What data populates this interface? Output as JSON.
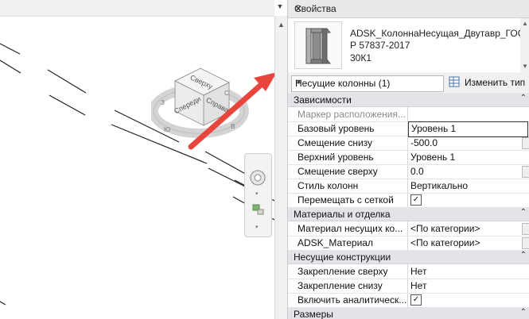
{
  "panel": {
    "title": "Свойства",
    "close_icon": "close-x-icon"
  },
  "type": {
    "line1": "ADSK_КолоннаНесущая_Двутавр_ГОСТ",
    "line2": "Р 57837-2017",
    "line3": "30К1"
  },
  "selector": {
    "value": "Несущие колонны (1)",
    "edit_type_label": "Изменить тип"
  },
  "viewcube": {
    "top": "Сверху",
    "front": "Спереди",
    "right": "Справа",
    "compass": [
      "С",
      "В",
      "Ю",
      "З"
    ]
  },
  "sections": [
    {
      "title": "Зависимости",
      "rows": [
        {
          "name": "Маркер расположения...",
          "value": "",
          "dim": true
        },
        {
          "name": "Базовый уровень",
          "value": "Уровень 1",
          "editing": true
        },
        {
          "name": "Смещение снизу",
          "value": "-500.0",
          "button": true
        },
        {
          "name": "Верхний уровень",
          "value": "Уровень 1"
        },
        {
          "name": "Смещение сверху",
          "value": "0.0",
          "button": true
        },
        {
          "name": "Стиль колонн",
          "value": "Вертикально"
        },
        {
          "name": "Перемещать с сеткой",
          "value": "",
          "checkbox": true,
          "checked": true
        }
      ]
    },
    {
      "title": "Материалы и отделка",
      "rows": [
        {
          "name": "Материал несущих ко...",
          "value": "<По категории>",
          "button": true
        },
        {
          "name": "ADSK_Материал",
          "value": "<По категории>",
          "button": true
        }
      ]
    },
    {
      "title": "Несущие конструкции",
      "rows": [
        {
          "name": "Закрепление сверху",
          "value": "Нет"
        },
        {
          "name": "Закрепление снизу",
          "value": "Нет"
        },
        {
          "name": "Включить аналитическ...",
          "value": "",
          "checkbox": true,
          "checked": true
        }
      ]
    },
    {
      "title": "Размеры",
      "rows": []
    }
  ],
  "colors": {
    "arrow": "#e8453c",
    "section_bg": "#e2e4e8",
    "panel_bg": "#f5f5f5"
  }
}
